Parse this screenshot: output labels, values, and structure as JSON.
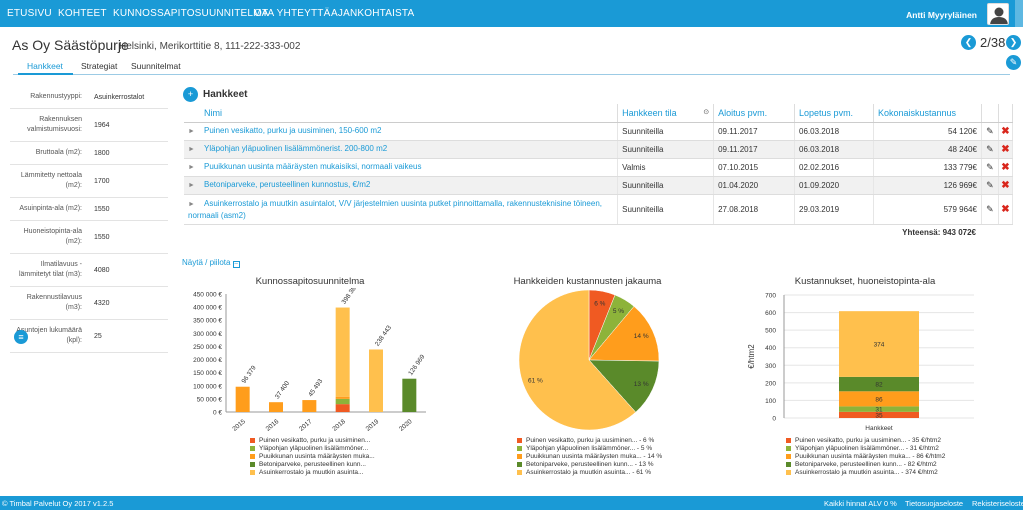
{
  "nav": {
    "items": [
      "ETUSIVU",
      "KOHTEET",
      "KUNNOSSAPITOSUUNNITELMA",
      "OTA YHTEYTTÄ",
      "AJANKOHTAISTA"
    ],
    "user": "Antti Myyryläinen"
  },
  "property": {
    "name": "As Oy Säästöpurje",
    "address": "Helsinki, Merikorttitie 8, 111-222-333-002",
    "pager": "2/38"
  },
  "tabs": [
    "Hankkeet",
    "Strategiat",
    "Suunnitelmat"
  ],
  "details": [
    {
      "label": "Rakennustyyppi:",
      "value": "Asuinkerrostalot"
    },
    {
      "label": "Rakennuksen valmistumisvuosi:",
      "value": "1964"
    },
    {
      "label": "Bruttoala (m2):",
      "value": "1800"
    },
    {
      "label": "Lämmitetty nettoala (m2):",
      "value": "1700"
    },
    {
      "label": "Asuinpinta-ala (m2):",
      "value": "1550"
    },
    {
      "label": "Huoneistopinta-ala (m2):",
      "value": "1550"
    },
    {
      "label": "Ilmatilavuus - lämmitetyt tilat (m3):",
      "value": "4080"
    },
    {
      "label": "Rakennustilavuus (m3):",
      "value": "4320"
    },
    {
      "label": "Asuntojen lukumäärä (kpl):",
      "value": "25"
    }
  ],
  "projects": {
    "title": "Hankkeet",
    "headers": [
      "Nimi",
      "Hankkeen tila",
      "Aloitus pvm.",
      "Lopetus pvm.",
      "Kokonaiskustannus"
    ],
    "rows": [
      {
        "name": "Puinen vesikatto, purku ja uusiminen, 150-600 m2",
        "status": "Suunniteilla",
        "start": "09.11.2017",
        "end": "06.03.2018",
        "cost": "54 120€"
      },
      {
        "name": "Yläpohjan yläpuolinen lisälämmönerist. 200-800 m2",
        "status": "Suunniteilla",
        "start": "09.11.2017",
        "end": "06.03.2018",
        "cost": "48 240€"
      },
      {
        "name": "Puuikkunan uusinta määräysten mukaisiksi, normaali vaikeus",
        "status": "Valmis",
        "start": "07.10.2015",
        "end": "02.02.2016",
        "cost": "133 779€"
      },
      {
        "name": "Betoniparveke, perusteellinen kunnostus, €/m2",
        "status": "Suunniteilla",
        "start": "01.04.2020",
        "end": "01.09.2020",
        "cost": "126 969€"
      },
      {
        "name": "Asuinkerrostalo ja muutkin asuintalot, V/V järjestelmien uusinta putket pinnoittamalla, rakennusteknisine töineen, normaali (asm2)",
        "status": "Suunniteilla",
        "start": "27.08.2018",
        "end": "29.03.2019",
        "cost": "579 964€"
      }
    ],
    "total": "Yhteensä: 943 072€",
    "showhide": "Näytä / piilota"
  },
  "colors": {
    "c1": "#f05a22",
    "c2": "#8db33a",
    "c3": "#ff9d1c",
    "c4": "#5a8a2a",
    "c5": "#ffc04d"
  },
  "chart_data": [
    {
      "type": "bar",
      "title": "Kunnossapitosuunnitelma",
      "categories": [
        "2015",
        "2016",
        "2017",
        "2018",
        "2019",
        "2020"
      ],
      "totals": [
        "96 379",
        "37 400",
        "45 493",
        "398 387",
        "238 443",
        "126 969"
      ],
      "series": [
        {
          "name": "Puinen vesikatto, purku ja uusiminen...",
          "values": [
            0,
            0,
            0,
            30000,
            0,
            0
          ]
        },
        {
          "name": "Yläpohjan yläpuolinen lisälämmöner...",
          "values": [
            0,
            0,
            0,
            20000,
            0,
            0
          ]
        },
        {
          "name": "Puuikkunan uusinta määräysten muka...",
          "values": [
            96379,
            37400,
            45493,
            8387,
            0,
            0
          ]
        },
        {
          "name": "Betoniparveke, perusteellinen kunn...",
          "values": [
            0,
            0,
            0,
            0,
            0,
            126969
          ]
        },
        {
          "name": "Asuinkerrostalo ja muutkin asuinta...",
          "values": [
            0,
            0,
            0,
            340000,
            238443,
            0
          ]
        }
      ],
      "yticks": [
        "450 000 €",
        "400 000 €",
        "350 000 €",
        "300 000 €",
        "250 000 €",
        "200 000 €",
        "150 000 €",
        "100 000 €",
        "50 000 €",
        "0 €"
      ],
      "ylim": [
        0,
        450000
      ]
    },
    {
      "type": "pie",
      "title": "Hankkeiden kustannusten jakauma",
      "slices": [
        {
          "label": "Puinen vesikatto, purku ja uusiminen... - 6 %",
          "value": 6
        },
        {
          "label": "Yläpohjan yläpuolinen lisälämmöner... - 5 %",
          "value": 5
        },
        {
          "label": "Puuikkunan uusinta määräysten muka... - 14 %",
          "value": 14
        },
        {
          "label": "Betoniparveke, perusteellinen kunn... - 13 %",
          "value": 13
        },
        {
          "label": "Asuinkerrostalo ja muutkin asuinta... - 61 %",
          "value": 61
        }
      ]
    },
    {
      "type": "bar",
      "title": "Kustannukset, huoneistopinta-ala",
      "ylabel": "€/htm2",
      "category": "Hankkeet",
      "series": [
        {
          "name": "Puinen vesikatto, purku ja uusiminen... - 35 €/htm2",
          "value": 35
        },
        {
          "name": "Yläpohjan yläpuolinen lisälämmöner... - 31 €/htm2",
          "value": 31
        },
        {
          "name": "Puuikkunan uusinta määräysten muka... - 86 €/htm2",
          "value": 86
        },
        {
          "name": "Betoniparveke, perusteellinen kunn... - 82 €/htm2",
          "value": 82
        },
        {
          "name": "Asuinkerrostalo ja muutkin asuinta... - 374 €/htm2",
          "value": 374
        }
      ],
      "yticks": [
        "700",
        "600",
        "500",
        "400",
        "300",
        "200",
        "100",
        "0"
      ],
      "ylim": [
        0,
        700
      ]
    }
  ],
  "footer": {
    "left": "© Timbal Palvelut Oy 2017 v1.2.5",
    "prices": "Kaikki hinnat ALV 0 %",
    "privacy": "Tietosuojaseloste",
    "register": "Rekisteriseloste"
  }
}
